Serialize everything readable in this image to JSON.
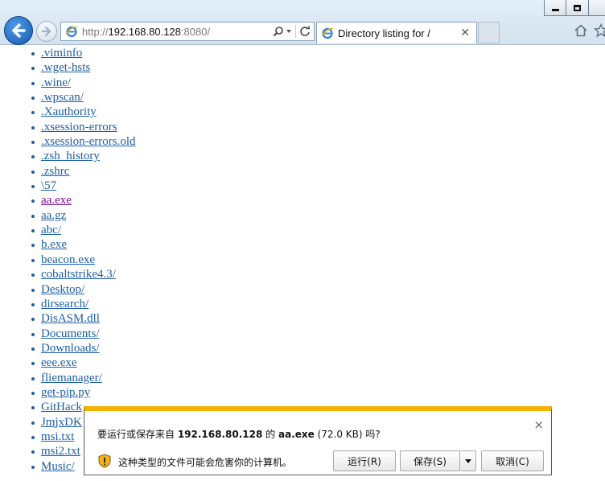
{
  "window": {
    "address": {
      "scheme": "http://",
      "host": "192.168.80.128",
      "port": ":8080/"
    },
    "tab": {
      "title": "Directory listing for /"
    }
  },
  "listing": [
    {
      "name": ".viminfo",
      "visited": false
    },
    {
      "name": ".wget-hsts",
      "visited": false
    },
    {
      "name": ".wine/",
      "visited": false
    },
    {
      "name": ".wpscan/",
      "visited": false
    },
    {
      "name": ".Xauthority",
      "visited": false
    },
    {
      "name": ".xsession-errors",
      "visited": false
    },
    {
      "name": ".xsession-errors.old",
      "visited": false
    },
    {
      "name": ".zsh_history",
      "visited": false
    },
    {
      "name": ".zshrc",
      "visited": false
    },
    {
      "name": "\\57",
      "visited": false
    },
    {
      "name": "aa.exe",
      "visited": true
    },
    {
      "name": "aa.gz",
      "visited": false
    },
    {
      "name": "abc/",
      "visited": false
    },
    {
      "name": "b.exe",
      "visited": false
    },
    {
      "name": "beacon.exe",
      "visited": false
    },
    {
      "name": "cobaltstrike4.3/",
      "visited": false
    },
    {
      "name": "Desktop/",
      "visited": false
    },
    {
      "name": "dirsearch/",
      "visited": false
    },
    {
      "name": "DisASM.dll",
      "visited": false
    },
    {
      "name": "Documents/",
      "visited": false
    },
    {
      "name": "Downloads/",
      "visited": false
    },
    {
      "name": "eee.exe",
      "visited": false
    },
    {
      "name": "fliemanager/",
      "visited": false
    },
    {
      "name": "get-pip.py",
      "visited": false
    },
    {
      "name": "GitHack",
      "visited": false
    },
    {
      "name": "JmjxDK",
      "visited": false
    },
    {
      "name": "msi.txt",
      "visited": false
    },
    {
      "name": "msi2.txt",
      "visited": false
    },
    {
      "name": "Music/",
      "visited": false
    }
  ],
  "download_bar": {
    "prompt_prefix": "要运行或保存来自 ",
    "host": "192.168.80.128",
    "prompt_mid": " 的 ",
    "filename": "aa.exe",
    "prompt_suffix": " (72.0 KB) 吗?",
    "warning": "这种类型的文件可能会危害你的计算机。",
    "run_label": "运行(R)",
    "save_label": "保存(S)",
    "cancel_label": "取消(C)",
    "close_glyph": "×"
  },
  "colors": {
    "link": "#1d5fa5",
    "visited": "#7a0a8a",
    "download_bar_accent": "#f4b100"
  }
}
